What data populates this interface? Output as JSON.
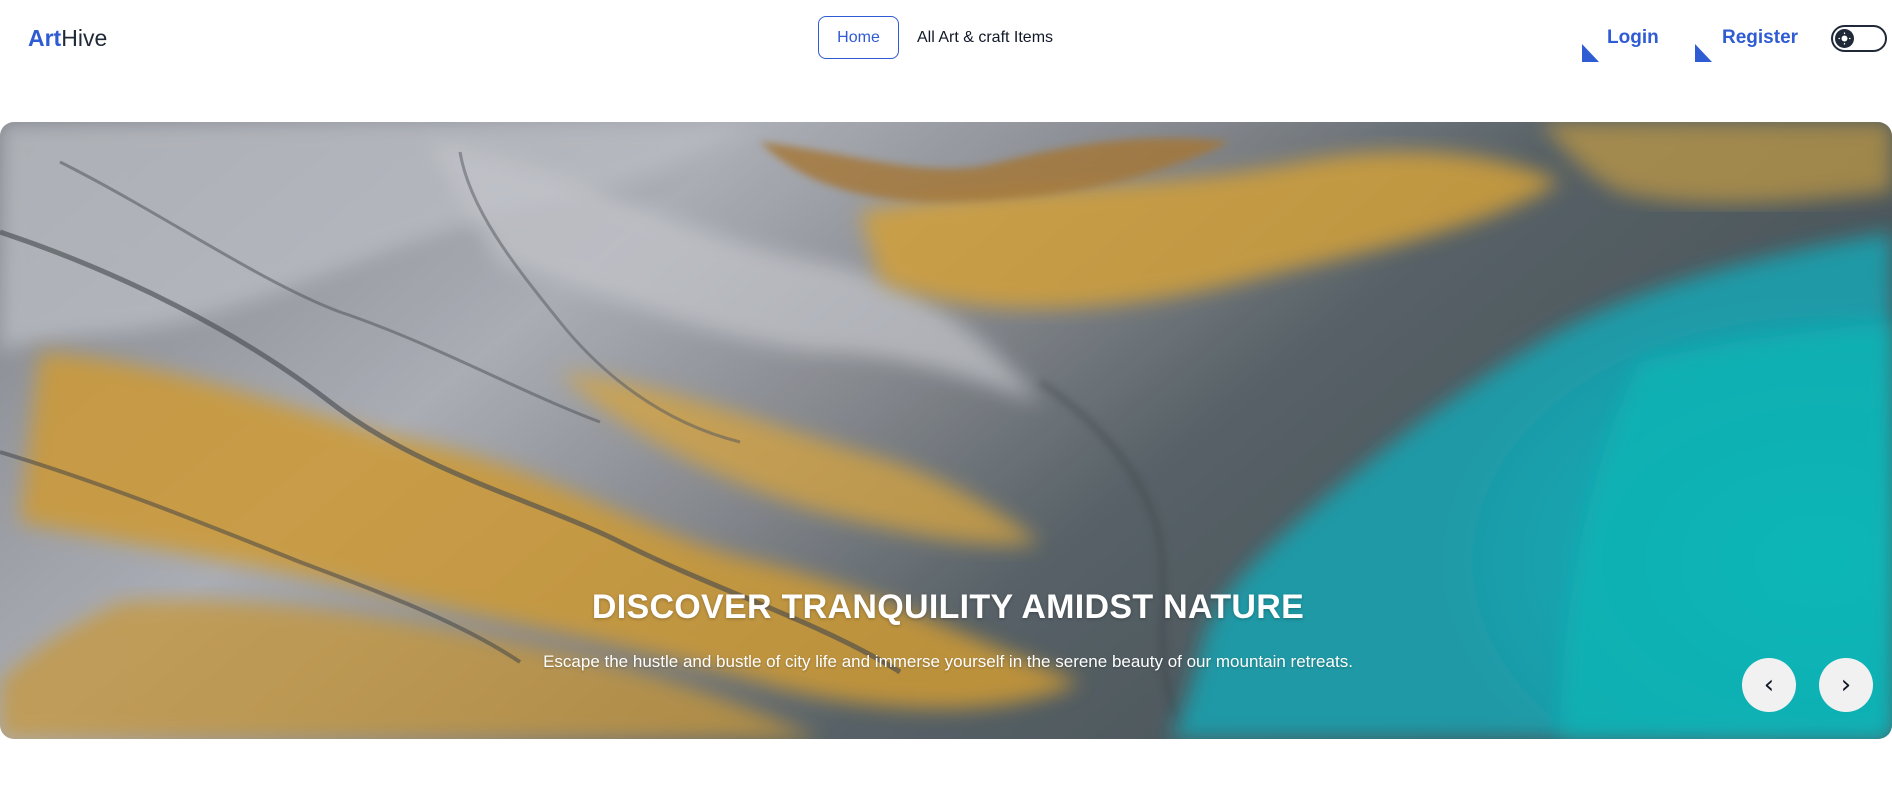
{
  "brand": {
    "accent": "Art",
    "rest": "Hive",
    "accent_color": "#2f5bd3"
  },
  "nav": {
    "home": "Home",
    "all_items": "All Art & craft Items"
  },
  "auth": {
    "login": "Login",
    "register": "Register"
  },
  "theme_toggle": {
    "icon": "sun-icon",
    "state": "light"
  },
  "hero": {
    "title": "DISCOVER TRANQUILITY AMIDST NATURE",
    "subtitle": "Escape the hustle and bustle of city life and immerse yourself in the serene beauty of our mountain retreats.",
    "image_description_icon": "aerial-landscape-image"
  },
  "carousel": {
    "prev": "‹",
    "next": "›"
  }
}
